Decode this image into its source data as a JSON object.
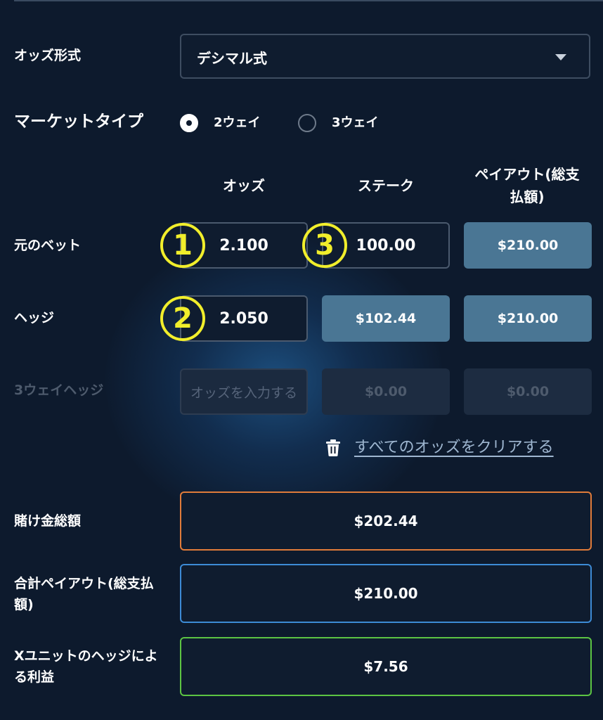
{
  "odds_format": {
    "label": "オッズ形式",
    "selected": "デシマル式"
  },
  "market_type": {
    "label": "マーケットタイプ",
    "options": [
      {
        "label": "2ウェイ",
        "checked": true
      },
      {
        "label": "3ウェイ",
        "checked": false
      }
    ]
  },
  "columns": {
    "odds": "オッズ",
    "stake": "ステーク",
    "payout_line1": "ペイアウト(総支",
    "payout_line2": "払額)"
  },
  "rows": [
    {
      "label": "元のベット",
      "odds": "2.100",
      "stake": "100.00",
      "payout": "$210.00",
      "odds_marker": "1",
      "stake_marker": "3"
    },
    {
      "label": "ヘッジ",
      "odds": "2.050",
      "stake": "$102.44",
      "payout": "$210.00",
      "odds_marker": "2"
    },
    {
      "label": "3ウェイヘッジ",
      "odds_placeholder": "オッズを入力する",
      "stake": "$0.00",
      "payout": "$0.00"
    }
  ],
  "clear_link": "すべてのオッズをクリアする",
  "totals": {
    "total_stake": {
      "label": "賭け金総額",
      "value": "$202.44"
    },
    "total_payout": {
      "label_line1": "合計ペイアウト(総支払",
      "label_line2": "額)",
      "value": "$210.00"
    },
    "profit": {
      "label_line1": "Xユニットのヘッジによ",
      "label_line2": "る利益",
      "value": "$7.56"
    }
  },
  "colors": {
    "background": "#0d1a2d",
    "marker": "#f1ee2b",
    "filled_box": "#4a7694",
    "total_stake_border": "#e07b3a",
    "total_payout_border": "#3d8bd6",
    "profit_border": "#5cc443"
  },
  "icons": {
    "dropdown": "chevron-down-icon",
    "clear": "trash-icon"
  }
}
